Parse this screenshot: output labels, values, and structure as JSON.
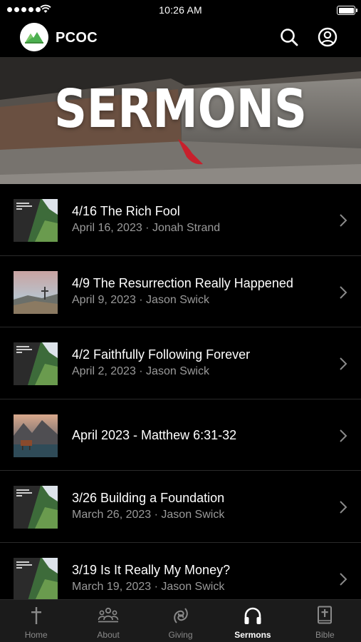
{
  "status_bar": {
    "time": "10:26 AM"
  },
  "header": {
    "title": "PCOC"
  },
  "hero": {
    "title": "SERMONS"
  },
  "sermons": [
    {
      "title": "4/16 The Rich Fool",
      "subtitle": "April 16, 2023 · Jonah Strand",
      "thumb": "parables"
    },
    {
      "title": "4/9 The Resurrection Really Happened",
      "subtitle": "April 9, 2023 · Jason Swick",
      "thumb": "cross"
    },
    {
      "title": "4/2 Faithfully Following Forever",
      "subtitle": "April 2, 2023 · Jason Swick",
      "thumb": "parables"
    },
    {
      "title": "April 2023 - Matthew 6:31-32",
      "subtitle": "",
      "thumb": "lake"
    },
    {
      "title": "3/26 Building a Foundation",
      "subtitle": "March 26, 2023 · Jason Swick",
      "thumb": "parables"
    },
    {
      "title": "3/19 Is It Really My Money?",
      "subtitle": "March 19, 2023 · Jason Swick",
      "thumb": "parables"
    }
  ],
  "tabs": [
    {
      "label": "Home",
      "icon": "cross-icon"
    },
    {
      "label": "About",
      "icon": "people-icon"
    },
    {
      "label": "Giving",
      "icon": "giving-icon"
    },
    {
      "label": "Sermons",
      "icon": "headphones-icon",
      "active": true
    },
    {
      "label": "Bible",
      "icon": "bible-icon"
    }
  ],
  "colors": {
    "background": "#000000",
    "tab_bar": "#1b1b1b",
    "subtitle": "#9a9a9a",
    "logo_green": "#5cb84c"
  }
}
